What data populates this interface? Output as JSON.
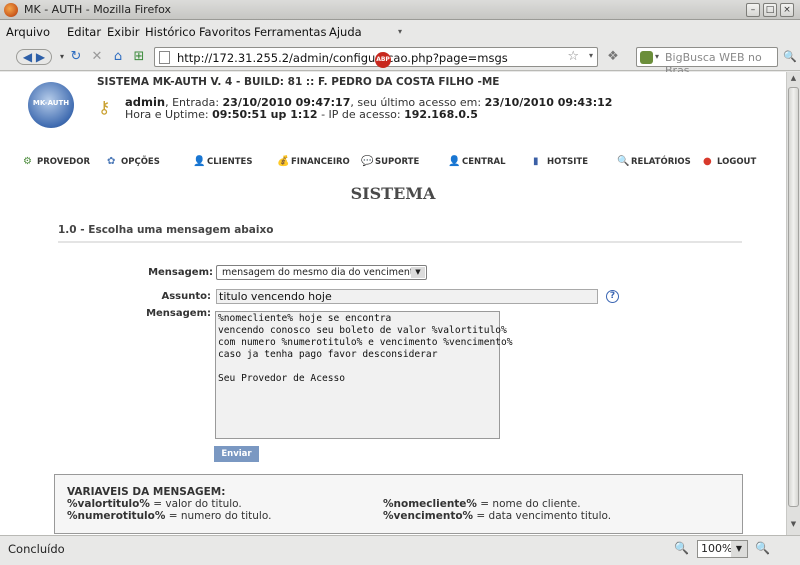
{
  "window": {
    "title": "MK - AUTH - Mozilla Firefox"
  },
  "menu": [
    "Arquivo",
    "Editar",
    "Exibir",
    "Histórico",
    "Favoritos",
    "Ferramentas",
    "Ajuda"
  ],
  "browser": {
    "url": "http://172.31.255.2/admin/configuracao.php?page=msgs",
    "search_placeholder": "BigBusca WEB no Bras",
    "status": "Concluído",
    "zoom": "100%"
  },
  "header": {
    "logo": "MK-AUTH",
    "system": "SISTEMA MK-AUTH V. 4 - BUILD: 81 :: F. PEDRO DA COSTA FILHO -ME",
    "user": "admin",
    "entry_label": ", Entrada:",
    "entry": "23/10/2010 09:47:17",
    "last_label": ", seu último acesso em:",
    "last": "23/10/2010 09:43:12",
    "uptime_label": "Hora e Uptime:",
    "uptime": "09:50:51 up 1:12",
    "ip_label": "- IP de acesso:",
    "ip": "192.168.0.5"
  },
  "nav": [
    {
      "label": "PROVEDOR",
      "icon": "gear-icon",
      "glyph": "⚙",
      "color": "#4a8a3a"
    },
    {
      "label": "OPÇÕES",
      "icon": "options-icon",
      "glyph": "✿",
      "color": "#4d7ab8"
    },
    {
      "label": "CLIENTES",
      "icon": "user-icon",
      "glyph": "👤",
      "color": "#c49434"
    },
    {
      "label": "FINANCEIRO",
      "icon": "money-icon",
      "glyph": "💰",
      "color": "#c6a02f"
    },
    {
      "label": "SUPORTE",
      "icon": "chat-icon",
      "glyph": "💬",
      "color": "#6cb23e"
    },
    {
      "label": "CENTRAL",
      "icon": "central-icon",
      "glyph": "👤",
      "color": "#b06b2e"
    },
    {
      "label": "HOTSITE",
      "icon": "hotsite-icon",
      "glyph": "▮",
      "color": "#3b5fa5"
    },
    {
      "label": "RELATÓRIOS",
      "icon": "report-icon",
      "glyph": "🔍",
      "color": "#4d6fae"
    },
    {
      "label": "LOGOUT",
      "icon": "logout-icon",
      "glyph": "●",
      "color": "#d83a2c"
    }
  ],
  "page": {
    "title": "SISTEMA",
    "subtitle": "1.0 - Escolha uma mensagem abaixo",
    "labels": {
      "mensagem": "Mensagem:",
      "assunto": "Assunto:",
      "mensagem_body": "Mensagem:"
    },
    "select_value": "mensagem do mesmo dia do vencimento",
    "assunto_value": "titulo vencendo hoje",
    "message": "%nomecliente% hoje se encontra\nvencendo conosco seu boleto de valor %valortitulo%\ncom numero %numerotitulo% e vencimento %vencimento%\ncaso ja tenha pago favor desconsiderar\n\nSeu Provedor de Acesso",
    "submit": "Enviar",
    "vars_title": "VARIAVEIS DA MENSAGEM:",
    "vars": [
      {
        "name": "%valortitulo%",
        "desc": " = valor do titulo."
      },
      {
        "name": "%nomecliente%",
        "desc": " = nome do cliente."
      },
      {
        "name": "%numerotitulo%",
        "desc": " = numero do titulo."
      },
      {
        "name": "%vencimento%",
        "desc": " = data vencimento titulo."
      }
    ]
  }
}
